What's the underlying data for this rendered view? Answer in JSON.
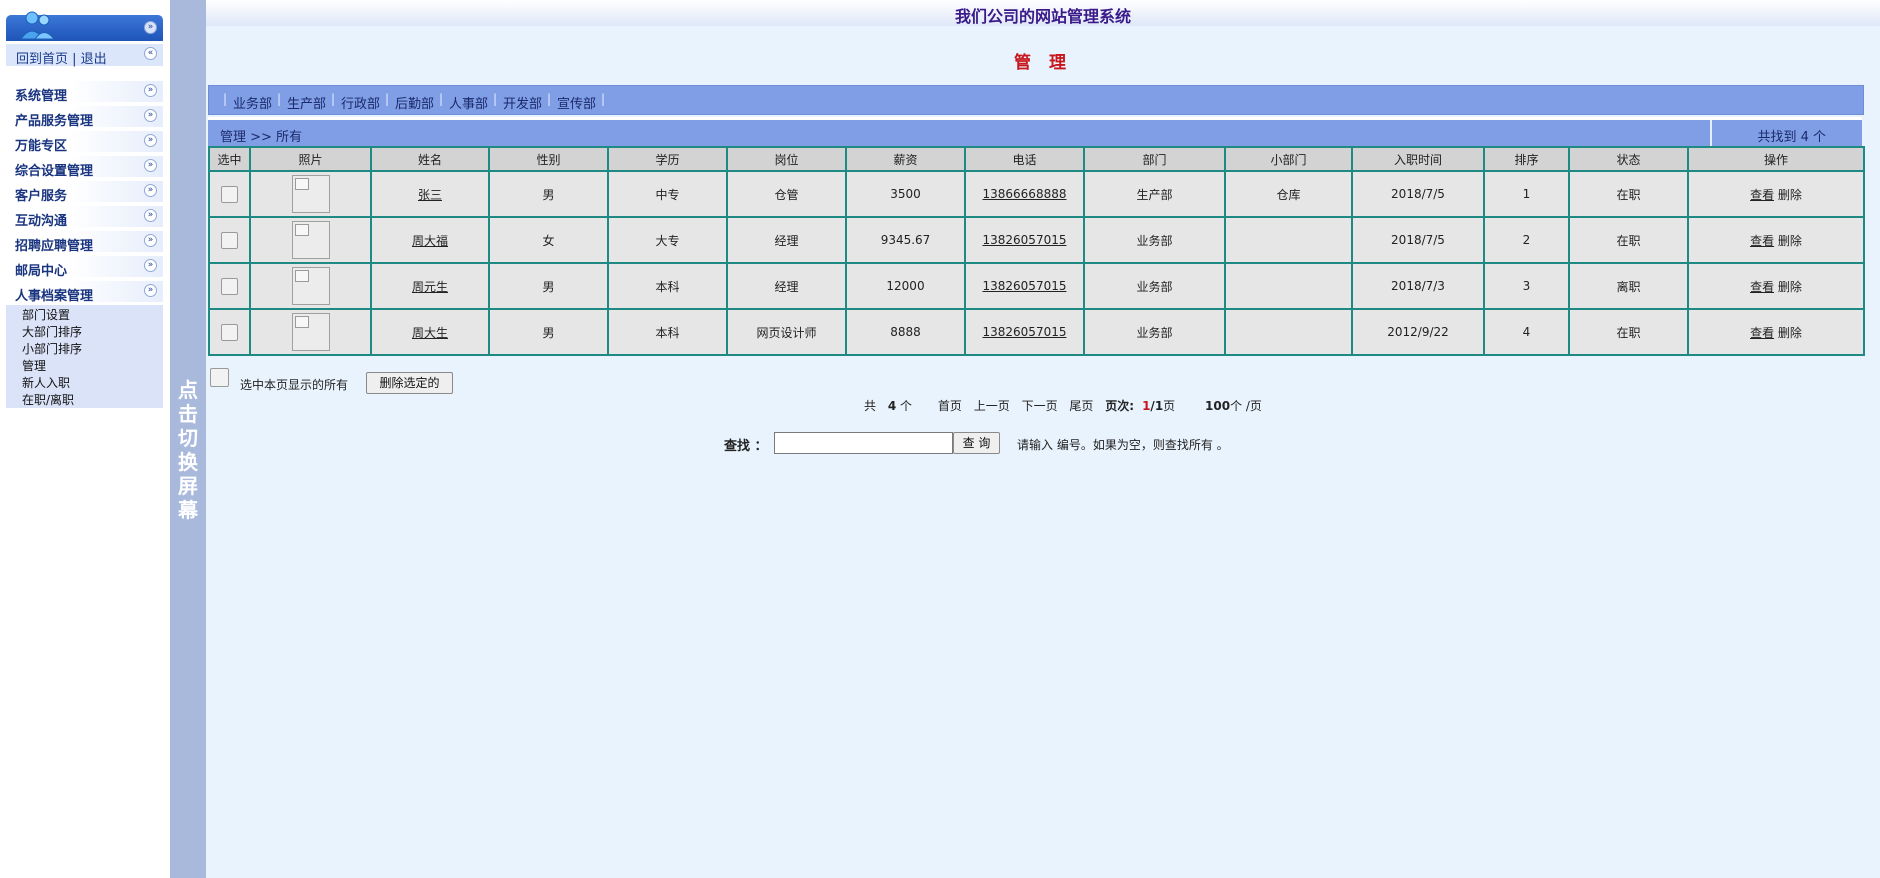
{
  "sidebar": {
    "home_label": "回到首页",
    "logout_label": "退出",
    "menu": [
      "系统管理",
      "产品服务管理",
      "万能专区",
      "综合设置管理",
      "客户服务",
      "互动沟通",
      "招聘应聘管理",
      "邮局中心",
      "人事档案管理"
    ],
    "submenu": [
      "部门设置",
      "大部门排序",
      "小部门排序",
      "管理",
      "新人入职",
      "在职/离职"
    ]
  },
  "switch_text": "点击切换屏幕",
  "header": {
    "site_title": "我们公司的网站管理系统",
    "page_heading": "管 理"
  },
  "departments": [
    "业务部",
    "生产部",
    "行政部",
    "后勤部",
    "人事部",
    "开发部",
    "宣传部"
  ],
  "breadcrumb": "管理 >> 所有",
  "found_text": "共找到 4 个",
  "table": {
    "columns": [
      "选中",
      "照片",
      "姓名",
      "性别",
      "学历",
      "岗位",
      "薪资",
      "电话",
      "部门",
      "小部门",
      "入职时间",
      "排序",
      "状态",
      "操作"
    ],
    "rows": [
      {
        "name": "张三",
        "gender": "男",
        "edu": "中专",
        "post": "仓管",
        "salary": "3500",
        "phone": "13866668888",
        "dept": "生产部",
        "subdept": "仓库",
        "date": "2018/7/5",
        "order": "1",
        "status": "在职"
      },
      {
        "name": "周大福",
        "gender": "女",
        "edu": "大专",
        "post": "经理",
        "salary": "9345.67",
        "phone": "13826057015",
        "dept": "业务部",
        "subdept": "",
        "date": "2018/7/5",
        "order": "2",
        "status": "在职"
      },
      {
        "name": "周元生",
        "gender": "男",
        "edu": "本科",
        "post": "经理",
        "salary": "12000",
        "phone": "13826057015",
        "dept": "业务部",
        "subdept": "",
        "date": "2018/7/3",
        "order": "3",
        "status": "离职"
      },
      {
        "name": "周大生",
        "gender": "男",
        "edu": "本科",
        "post": "网页设计师",
        "salary": "8888",
        "phone": "13826057015",
        "dept": "业务部",
        "subdept": "",
        "date": "2012/9/22",
        "order": "4",
        "status": "在职"
      }
    ],
    "op_view": "查看",
    "op_delete": "删除"
  },
  "bulk": {
    "select_all_label": "选中本页显示的所有",
    "delete_button": "删除选定的"
  },
  "pager": {
    "total_prefix": "共",
    "total": "4",
    "total_suffix": "个",
    "first": "首页",
    "prev": "上一页",
    "next": "下一页",
    "last": "尾页",
    "page_label": "页次:",
    "page_current": "1",
    "page_sep": "/",
    "page_total": "1",
    "page_suffix": "页",
    "per_page": "100",
    "per_page_suffix": "个 /页"
  },
  "search": {
    "label": "查找 ：",
    "value": "",
    "button": "查 询",
    "hint": "请输入 编号。如果为空，则查找所有 。"
  },
  "colors": {
    "bar_blue": "#7f9ee6",
    "table_border": "#1f8a84",
    "heading_red": "#c8161d",
    "inactive_red": "#d01818",
    "main_bg": "#e9f3fd"
  }
}
